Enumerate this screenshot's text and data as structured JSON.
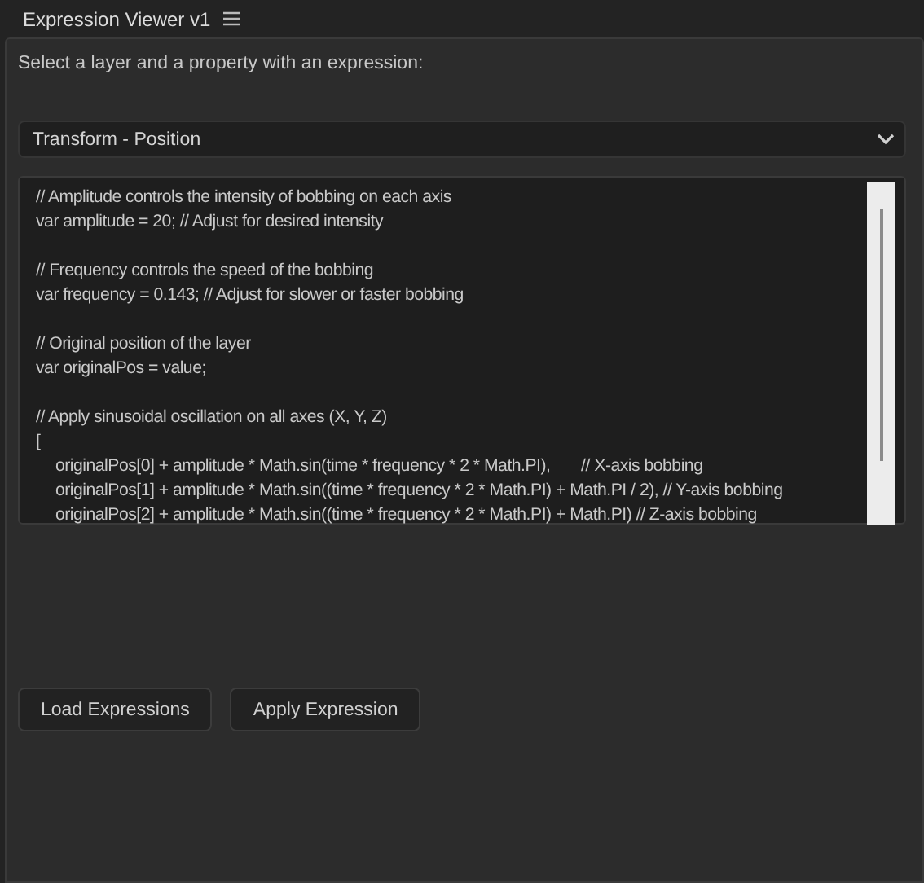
{
  "panel": {
    "title": "Expression Viewer v1"
  },
  "prompt": "Select a layer and a property with an expression:",
  "property_select": {
    "value": "Transform - Position"
  },
  "code_blocks": [
    [
      {
        "text": "// Amplitude controls the intensity of bobbing on each axis"
      },
      {
        "text": "var amplitude = 20; // Adjust for desired intensity"
      }
    ],
    [
      {
        "text": "// Frequency controls the speed of the bobbing"
      },
      {
        "text": "var frequency = 0.143; // Adjust for slower or faster bobbing"
      }
    ],
    [
      {
        "text": "// Original position of the layer"
      },
      {
        "text": "var originalPos = value;"
      }
    ],
    [
      {
        "text": "// Apply sinusoidal oscillation on all axes (X, Y, Z)"
      },
      {
        "text": "[",
        "children": [
          {
            "text": "originalPos[0] + amplitude * Math.sin(time * frequency * 2 * Math.PI),       // X-axis bobbing"
          },
          {
            "text": "originalPos[1] + amplitude * Math.sin((time * frequency * 2 * Math.PI) + Math.PI / 2), // Y-axis bobbing"
          },
          {
            "text": "originalPos[2] + amplitude * Math.sin((time * frequency * 2 * Math.PI) + Math.PI) // Z-axis bobbing"
          }
        ]
      }
    ]
  ],
  "buttons": [
    "Load Expressions",
    "Apply Expression"
  ]
}
